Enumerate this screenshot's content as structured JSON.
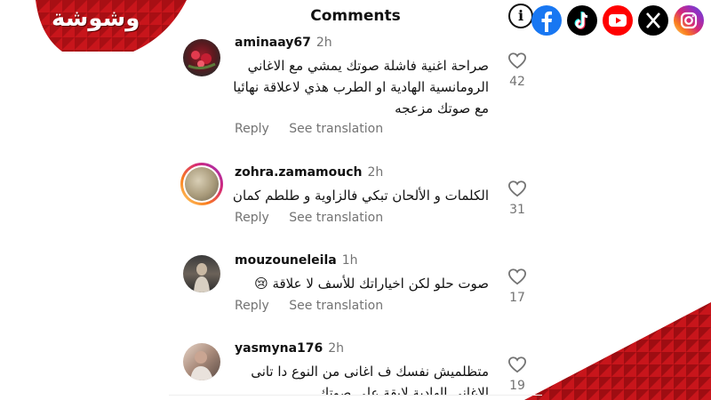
{
  "header": {
    "title": "Comments"
  },
  "brand": {
    "logo_text": "وشوشة",
    "color": "#c8151b"
  },
  "socials": [
    {
      "icon": "info-icon"
    },
    {
      "icon": "facebook-icon",
      "color": "#1877f2"
    },
    {
      "icon": "tiktok-icon",
      "color": "#000000"
    },
    {
      "icon": "youtube-icon",
      "color": "#ff0000"
    },
    {
      "icon": "x-icon",
      "color": "#000000"
    },
    {
      "icon": "instagram-icon",
      "color": "#d62976"
    }
  ],
  "comments": [
    {
      "username": "aminaay67",
      "time": "2h",
      "text_lines": [
        "صراحة اغنية فاشلة صوتك يمشي مع الاغاني",
        "الرومانسية الهادية او الطرب هذي لاعلاقة نهائيا",
        "مع صوتك مزعجه"
      ],
      "reply": "Reply",
      "translate": "See translation",
      "likes": "42"
    },
    {
      "username": "zohra.zamamouch",
      "time": "2h",
      "text_lines": [
        "الكلمات و الألحان تبكي فالزاوية و طلطم كمان"
      ],
      "reply": "Reply",
      "translate": "See translation",
      "likes": "31"
    },
    {
      "username": "mouzouneleila",
      "time": "1h",
      "text_lines": [
        "صوت حلو لكن اخياراتك للأسف لا علاقة 😢"
      ],
      "reply": "Reply",
      "translate": "See translation",
      "likes": "17"
    },
    {
      "username": "yasmyna176",
      "time": "2h",
      "text_lines": [
        "متظلميش نفسك ف اغانى من النوع دا تانى",
        "الاغانى الهادية لايقة على صوتك"
      ],
      "likes": "19"
    }
  ]
}
